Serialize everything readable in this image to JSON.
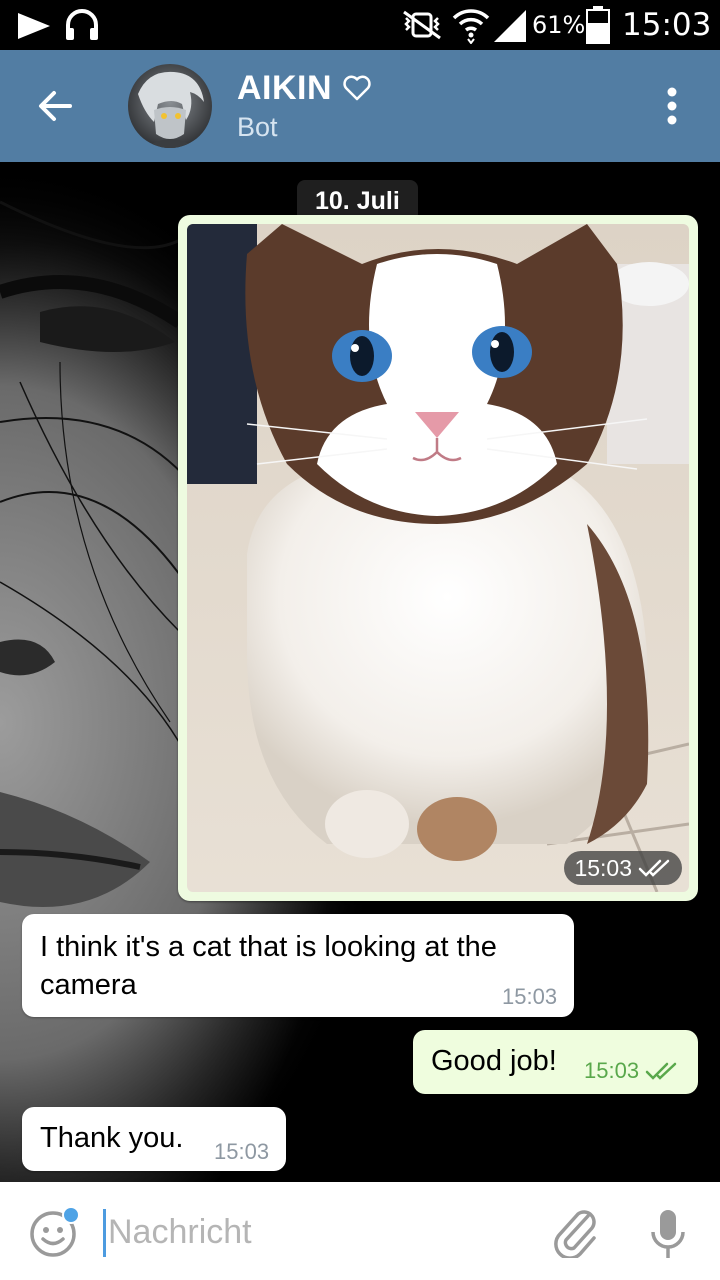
{
  "status_bar": {
    "battery_percent": "61%",
    "time": "15:03",
    "icons": [
      "play-icon",
      "headphones-icon",
      "vibrate-mute-icon",
      "wifi-icon",
      "signal-icon",
      "battery-icon"
    ]
  },
  "header": {
    "title": "AIKIN",
    "subtitle": "Bot",
    "icons": [
      "back-arrow-icon",
      "heart-icon",
      "more-vert-icon"
    ],
    "color": "#527da3"
  },
  "chat": {
    "date": "10. Juli",
    "messages": [
      {
        "type": "photo",
        "direction": "out",
        "time": "15:03",
        "status": "read"
      },
      {
        "type": "text",
        "direction": "in",
        "text": "I think it's a cat that is looking at the camera",
        "time": "15:03"
      },
      {
        "type": "text",
        "direction": "out",
        "text": "Good job!",
        "time": "15:03",
        "status": "read"
      },
      {
        "type": "text",
        "direction": "in",
        "text": "Thank you.",
        "time": "15:03"
      }
    ]
  },
  "input": {
    "placeholder": "Nachricht",
    "value": "",
    "icons": [
      "emoji-icon",
      "attach-icon",
      "mic-icon"
    ]
  },
  "colors": {
    "accent": "#527da3",
    "outgoing_bubble": "#effdde",
    "read_check": "#59a84b"
  }
}
